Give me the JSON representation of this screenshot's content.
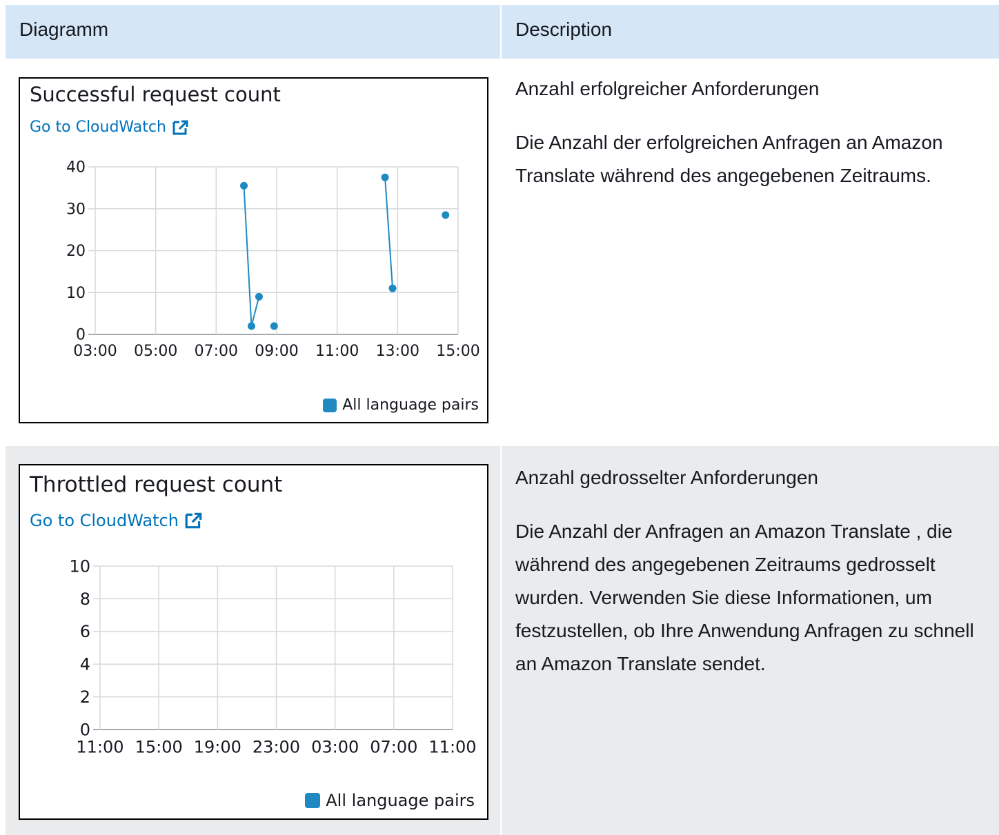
{
  "header": {
    "col1": "Diagramm",
    "col2": "Description"
  },
  "rows": [
    {
      "chart": {
        "title": "Successful request count",
        "link": "Go to CloudWatch",
        "legend": "All language pairs"
      },
      "description": {
        "title": "Anzahl erfolgreicher Anforderungen",
        "body": "Die Anzahl der erfolgreichen Anfragen an Amazon Translate während des angegebenen Zeitraums."
      }
    },
    {
      "chart": {
        "title": "Throttled request count",
        "link": "Go to CloudWatch",
        "legend": "All language pairs"
      },
      "description": {
        "title": "Anzahl gedrosselter Anforderungen",
        "body": "Die Anzahl der Anfragen an Amazon Translate , die während des angegebenen Zeitraums gedrosselt wurden. Verwenden Sie diese Informationen, um festzustellen, ob Ihre Anwendung Anfragen zu schnell an Amazon Translate sendet."
      }
    }
  ],
  "colors": {
    "header_bg": "#d5e6f6",
    "row2_bg": "#e9ebed",
    "series": "#1f8ac2",
    "link": "#0073bb"
  },
  "chart_data": [
    {
      "type": "line",
      "title": "Successful request count",
      "x_ticks": [
        "03:00",
        "05:00",
        "07:00",
        "09:00",
        "11:00",
        "13:00",
        "15:00"
      ],
      "y_ticks": [
        0,
        10,
        20,
        30,
        40
      ],
      "ylim": [
        0,
        40
      ],
      "grid": true,
      "legend_position": "bottom-right",
      "series": [
        {
          "name": "All language pairs",
          "points": [
            {
              "x": "07:55",
              "y": 35.5
            },
            {
              "x": "08:10",
              "y": 2
            },
            {
              "x": "08:25",
              "y": 9
            },
            null,
            {
              "x": "08:55",
              "y": 2
            },
            null,
            {
              "x": "12:35",
              "y": 37.5
            },
            {
              "x": "12:50",
              "y": 11
            },
            null,
            {
              "x": "14:35",
              "y": 28.5
            }
          ]
        }
      ]
    },
    {
      "type": "line",
      "title": "Throttled request count",
      "x_ticks": [
        "11:00",
        "15:00",
        "19:00",
        "23:00",
        "03:00",
        "07:00",
        "11:00"
      ],
      "y_ticks": [
        0,
        2,
        4,
        6,
        8,
        10
      ],
      "ylim": [
        0,
        10
      ],
      "grid": true,
      "legend_position": "bottom-right",
      "series": [
        {
          "name": "All language pairs",
          "points": []
        }
      ]
    }
  ]
}
